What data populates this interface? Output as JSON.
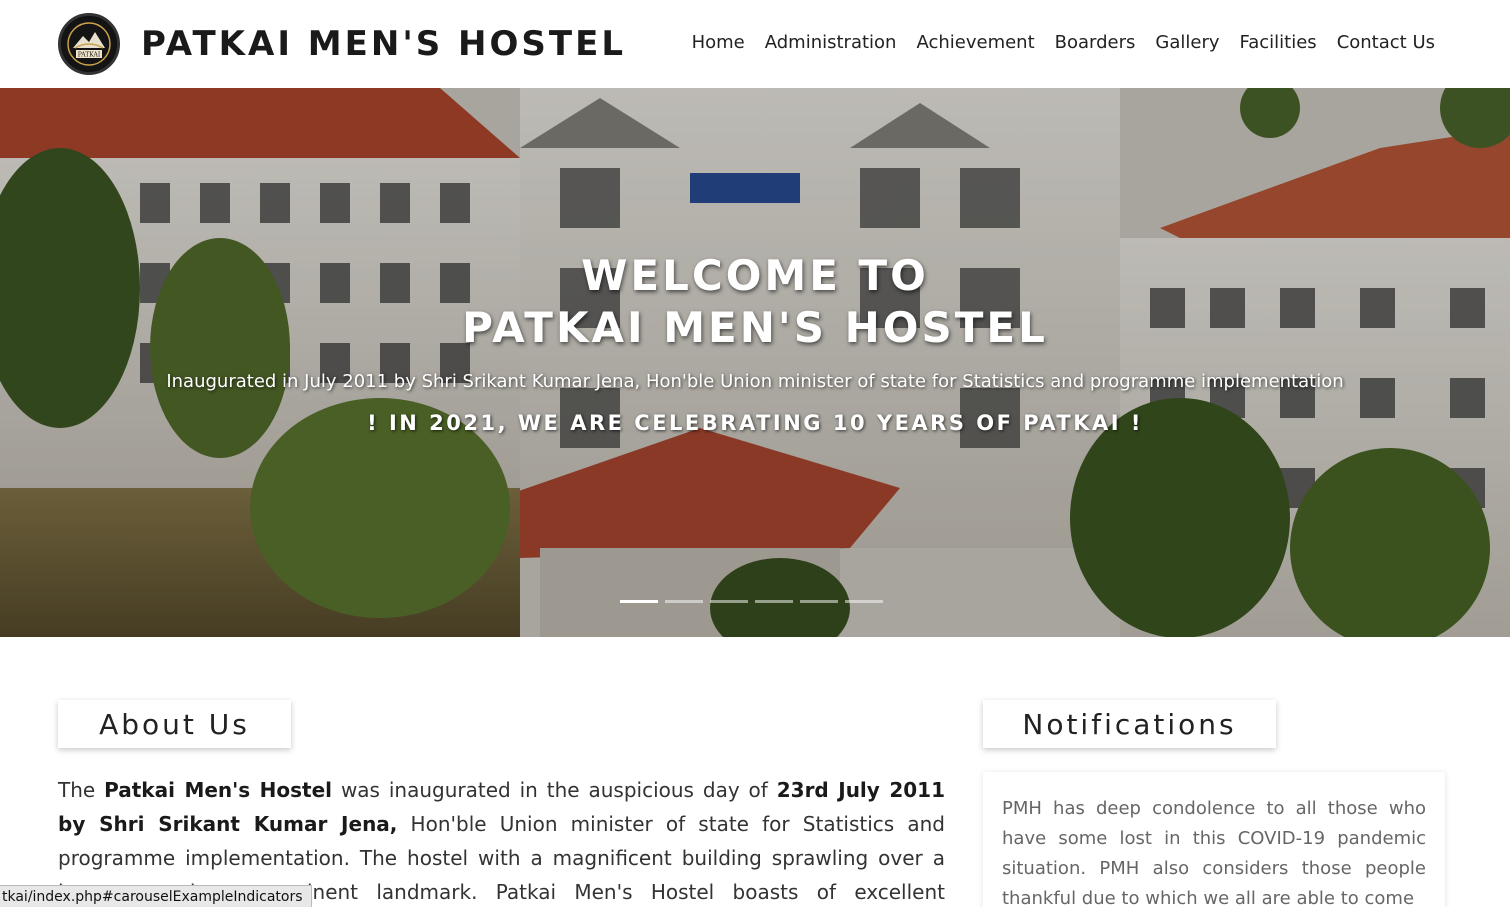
{
  "header": {
    "logo_text": "PATKAI",
    "title": "PATKAI MEN'S HOSTEL",
    "nav": [
      "Home",
      "Administration",
      "Achievement",
      "Boarders",
      "Gallery",
      "Facilities",
      "Contact Us"
    ]
  },
  "hero": {
    "title_line1": "WELCOME TO",
    "title_line2": "PATKAI MEN'S HOSTEL",
    "subtitle": "Inaugurated in July 2011 by Shri Srikant Kumar Jena, Hon'ble Union minister of state for Statistics and programme implementation",
    "celebrate": "! IN 2021, WE ARE CELEBRATING 10 YEARS OF PATKAI !",
    "slide_count": 6,
    "active_slide": 1
  },
  "about": {
    "heading": "About Us",
    "p1": "The ",
    "b1": "Patkai Men's Hostel",
    "p2": " was inaugurated in the auspicious day of ",
    "b2": "23rd July 2011 by Shri Srikant Kumar Jena,",
    "p3": " Hon'ble Union minister of state for Statistics and programme implementation. The hostel with a magnificent building sprawling over a large area is a prominent landmark. Patkai Men's Hostel boasts of excellent infrastructure with a fully"
  },
  "notifications": {
    "heading": "Notifications",
    "text": "PMH has deep condolence to all those who have some lost in this COVID-19 pandemic situation. PMH also considers those people thankful due to which we all are able to come"
  },
  "status_url": "tkai/index.php#carouselExampleIndicators",
  "colors": {
    "roof": "#b84a34",
    "building": "#e4e1da",
    "foliage": "#4f6a2c"
  }
}
